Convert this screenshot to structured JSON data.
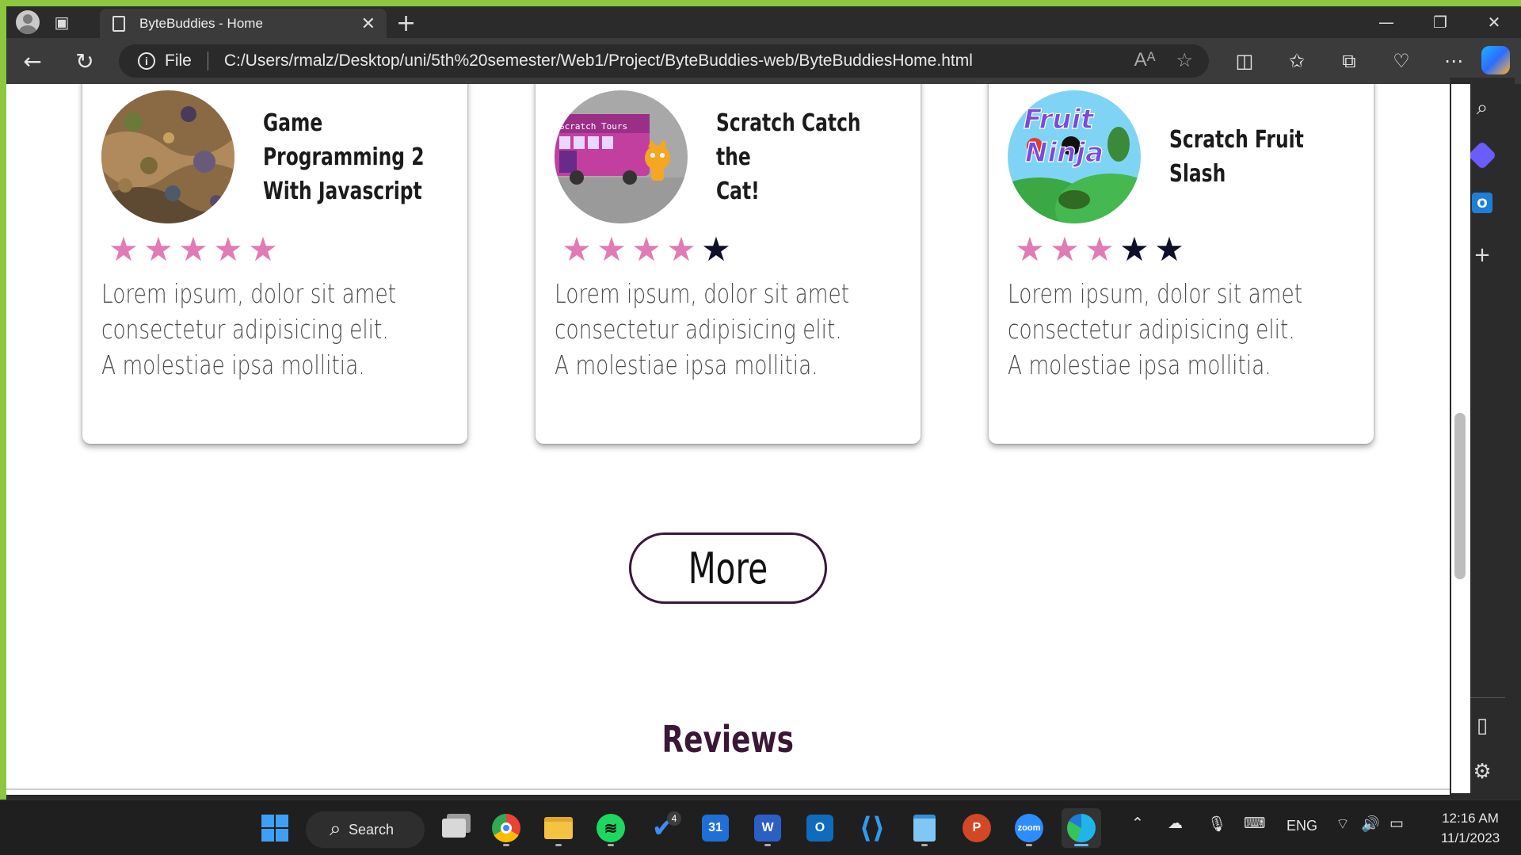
{
  "browser": {
    "tab_title": "ByteBuddies - Home",
    "address_scheme": "File",
    "address_url": "C:/Users/rmalz/Desktop/uni/5th%20semester/Web1/Project/ByteBuddies-web/ByteBuddiesHome.html"
  },
  "cards": [
    {
      "title_lines": [
        "Game",
        "Programming 2",
        "With Javascript"
      ],
      "rating": 5,
      "rating_max": 5,
      "description_lines": [
        "Lorem ipsum, dolor sit amet",
        "consectetur adipisicing elit.",
        "A molestiae ipsa mollitia."
      ]
    },
    {
      "title_lines": [
        "Scratch Catch the",
        "Cat!"
      ],
      "rating": 4,
      "rating_max": 5,
      "thumb_text": "Scratch Tours",
      "description_lines": [
        "Lorem ipsum, dolor sit amet",
        "consectetur adipisicing elit.",
        "A molestiae ipsa mollitia."
      ]
    },
    {
      "title_lines": [
        "Scratch Fruit",
        "Slash"
      ],
      "rating": 3,
      "rating_max": 5,
      "thumb_text_lines": [
        "Fruit",
        "Ninja"
      ],
      "description_lines": [
        "Lorem ipsum, dolor sit amet",
        "consectetur adipisicing elit.",
        "A molestiae ipsa mollitia."
      ]
    }
  ],
  "more_button_label": "More",
  "section_heading": "Reviews",
  "colors": {
    "star_filled": "#e07cb5",
    "star_empty": "#0f0f2a",
    "accent": "#3a1835"
  },
  "taskbar": {
    "search_label": "Search",
    "notification_badge": "4",
    "calendar_label": "31",
    "word_label": "W",
    "outlook_label": "O",
    "powerpoint_label": "P",
    "zoom_label": "zoom",
    "language": "ENG",
    "time": "12:16 AM",
    "date": "11/1/2023"
  },
  "sidebar": {
    "outlook_label": "O"
  }
}
